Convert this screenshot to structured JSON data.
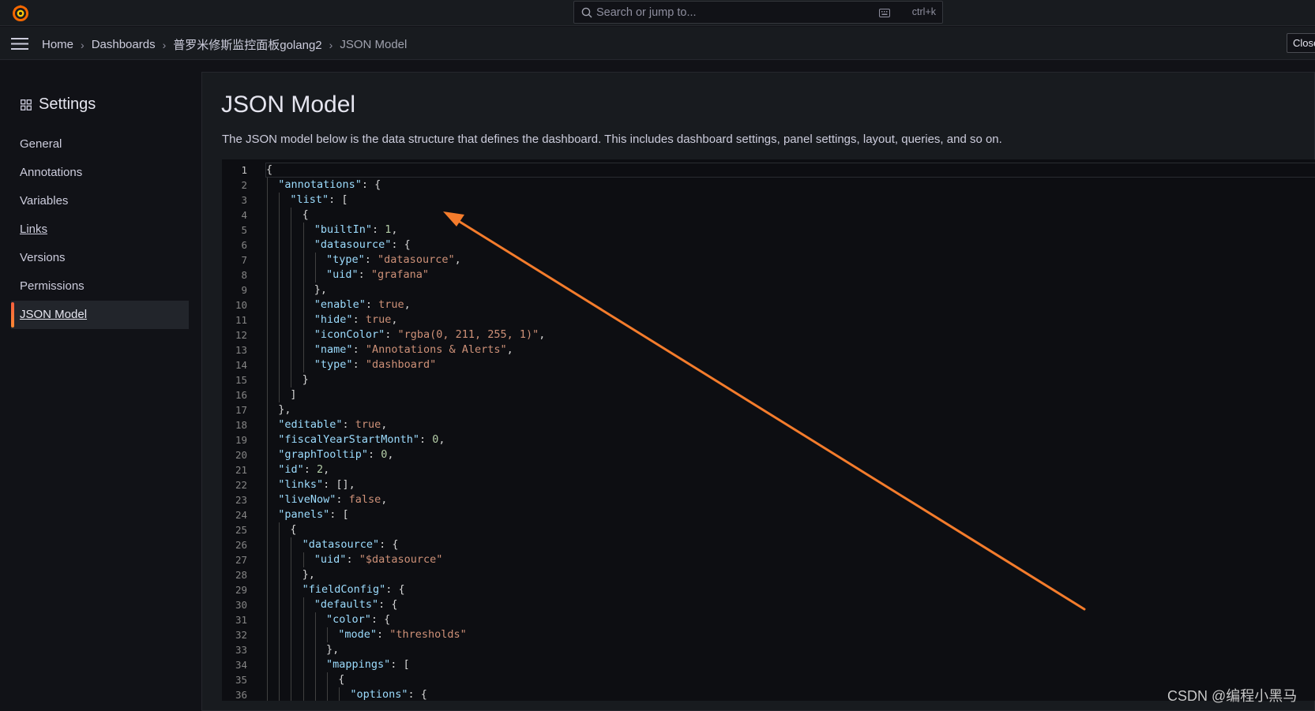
{
  "topbar": {
    "search_placeholder": "Search or jump to...",
    "shortcut": "ctrl+k"
  },
  "breadcrumb": {
    "items": [
      "Home",
      "Dashboards",
      "普罗米修斯监控面板golang2"
    ],
    "current": "JSON Model"
  },
  "navbar": {
    "close_label": "Close"
  },
  "sidebar": {
    "title": "Settings",
    "items": [
      {
        "label": "General"
      },
      {
        "label": "Annotations"
      },
      {
        "label": "Variables"
      },
      {
        "label": "Links"
      },
      {
        "label": "Versions"
      },
      {
        "label": "Permissions"
      },
      {
        "label": "JSON Model"
      }
    ],
    "active_item": "JSON Model"
  },
  "main": {
    "title": "JSON Model",
    "description": "The JSON model below is the data structure that defines the dashboard. This includes dashboard settings, panel settings, layout, queries, and so on."
  },
  "editor": {
    "lines": [
      {
        "indent": 0,
        "tokens": [
          [
            "p",
            "{"
          ]
        ]
      },
      {
        "indent": 1,
        "tokens": [
          [
            "k",
            "\"annotations\""
          ],
          [
            "p",
            ": {"
          ]
        ]
      },
      {
        "indent": 2,
        "tokens": [
          [
            "k",
            "\"list\""
          ],
          [
            "p",
            ": ["
          ]
        ]
      },
      {
        "indent": 3,
        "tokens": [
          [
            "p",
            "{"
          ]
        ]
      },
      {
        "indent": 4,
        "tokens": [
          [
            "k",
            "\"builtIn\""
          ],
          [
            "p",
            ": "
          ],
          [
            "n",
            "1"
          ],
          [
            "p",
            ","
          ]
        ]
      },
      {
        "indent": 4,
        "tokens": [
          [
            "k",
            "\"datasource\""
          ],
          [
            "p",
            ": {"
          ]
        ]
      },
      {
        "indent": 5,
        "tokens": [
          [
            "k",
            "\"type\""
          ],
          [
            "p",
            ": "
          ],
          [
            "s",
            "\"datasource\""
          ],
          [
            "p",
            ","
          ]
        ]
      },
      {
        "indent": 5,
        "tokens": [
          [
            "k",
            "\"uid\""
          ],
          [
            "p",
            ": "
          ],
          [
            "s",
            "\"grafana\""
          ]
        ]
      },
      {
        "indent": 4,
        "tokens": [
          [
            "p",
            "},"
          ]
        ]
      },
      {
        "indent": 4,
        "tokens": [
          [
            "k",
            "\"enable\""
          ],
          [
            "p",
            ": "
          ],
          [
            "b",
            "true"
          ],
          [
            "p",
            ","
          ]
        ]
      },
      {
        "indent": 4,
        "tokens": [
          [
            "k",
            "\"hide\""
          ],
          [
            "p",
            ": "
          ],
          [
            "b",
            "true"
          ],
          [
            "p",
            ","
          ]
        ]
      },
      {
        "indent": 4,
        "tokens": [
          [
            "k",
            "\"iconColor\""
          ],
          [
            "p",
            ": "
          ],
          [
            "s",
            "\"rgba(0, 211, 255, 1)\""
          ],
          [
            "p",
            ","
          ]
        ]
      },
      {
        "indent": 4,
        "tokens": [
          [
            "k",
            "\"name\""
          ],
          [
            "p",
            ": "
          ],
          [
            "s",
            "\"Annotations & Alerts\""
          ],
          [
            "p",
            ","
          ]
        ]
      },
      {
        "indent": 4,
        "tokens": [
          [
            "k",
            "\"type\""
          ],
          [
            "p",
            ": "
          ],
          [
            "s",
            "\"dashboard\""
          ]
        ]
      },
      {
        "indent": 3,
        "tokens": [
          [
            "p",
            "}"
          ]
        ]
      },
      {
        "indent": 2,
        "tokens": [
          [
            "p",
            "]"
          ]
        ]
      },
      {
        "indent": 1,
        "tokens": [
          [
            "p",
            "},"
          ]
        ]
      },
      {
        "indent": 1,
        "tokens": [
          [
            "k",
            "\"editable\""
          ],
          [
            "p",
            ": "
          ],
          [
            "b",
            "true"
          ],
          [
            "p",
            ","
          ]
        ]
      },
      {
        "indent": 1,
        "tokens": [
          [
            "k",
            "\"fiscalYearStartMonth\""
          ],
          [
            "p",
            ": "
          ],
          [
            "n",
            "0"
          ],
          [
            "p",
            ","
          ]
        ]
      },
      {
        "indent": 1,
        "tokens": [
          [
            "k",
            "\"graphTooltip\""
          ],
          [
            "p",
            ": "
          ],
          [
            "n",
            "0"
          ],
          [
            "p",
            ","
          ]
        ]
      },
      {
        "indent": 1,
        "tokens": [
          [
            "k",
            "\"id\""
          ],
          [
            "p",
            ": "
          ],
          [
            "n",
            "2"
          ],
          [
            "p",
            ","
          ]
        ]
      },
      {
        "indent": 1,
        "tokens": [
          [
            "k",
            "\"links\""
          ],
          [
            "p",
            ": [],"
          ]
        ]
      },
      {
        "indent": 1,
        "tokens": [
          [
            "k",
            "\"liveNow\""
          ],
          [
            "p",
            ": "
          ],
          [
            "b",
            "false"
          ],
          [
            "p",
            ","
          ]
        ]
      },
      {
        "indent": 1,
        "tokens": [
          [
            "k",
            "\"panels\""
          ],
          [
            "p",
            ": ["
          ]
        ]
      },
      {
        "indent": 2,
        "tokens": [
          [
            "p",
            "{"
          ]
        ]
      },
      {
        "indent": 3,
        "tokens": [
          [
            "k",
            "\"datasource\""
          ],
          [
            "p",
            ": {"
          ]
        ]
      },
      {
        "indent": 4,
        "tokens": [
          [
            "k",
            "\"uid\""
          ],
          [
            "p",
            ": "
          ],
          [
            "s",
            "\"$datasource\""
          ]
        ]
      },
      {
        "indent": 3,
        "tokens": [
          [
            "p",
            "},"
          ]
        ]
      },
      {
        "indent": 3,
        "tokens": [
          [
            "k",
            "\"fieldConfig\""
          ],
          [
            "p",
            ": {"
          ]
        ]
      },
      {
        "indent": 4,
        "tokens": [
          [
            "k",
            "\"defaults\""
          ],
          [
            "p",
            ": {"
          ]
        ]
      },
      {
        "indent": 5,
        "tokens": [
          [
            "k",
            "\"color\""
          ],
          [
            "p",
            ": {"
          ]
        ]
      },
      {
        "indent": 6,
        "tokens": [
          [
            "k",
            "\"mode\""
          ],
          [
            "p",
            ": "
          ],
          [
            "s",
            "\"thresholds\""
          ]
        ]
      },
      {
        "indent": 5,
        "tokens": [
          [
            "p",
            "},"
          ]
        ]
      },
      {
        "indent": 5,
        "tokens": [
          [
            "k",
            "\"mappings\""
          ],
          [
            "p",
            ": ["
          ]
        ]
      },
      {
        "indent": 6,
        "tokens": [
          [
            "p",
            "{"
          ]
        ]
      },
      {
        "indent": 7,
        "tokens": [
          [
            "k",
            "\"options\""
          ],
          [
            "p",
            ": {"
          ]
        ]
      }
    ]
  },
  "annotation": {
    "color": "#f47c2c"
  },
  "watermark": "CSDN @编程小黑马",
  "colors": {
    "background": "#111217",
    "panel": "#181b1f",
    "accent": "#ff8833",
    "json_key": "#9cdcfe",
    "json_string": "#ce9178",
    "json_number": "#b5cea8"
  }
}
